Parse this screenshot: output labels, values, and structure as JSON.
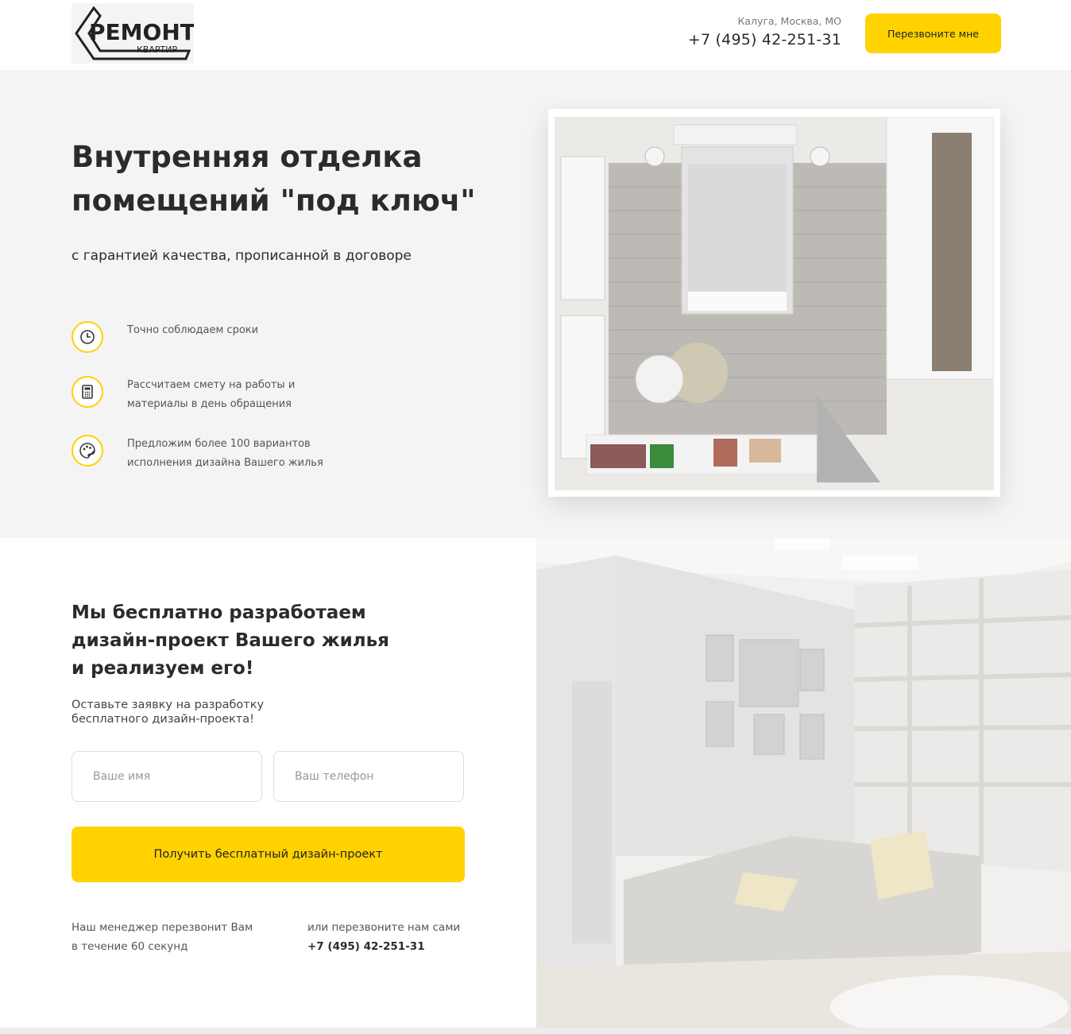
{
  "header": {
    "logo_word": "РЕМОНТ",
    "logo_sub": "КВАРТИР",
    "region": "Калуга, Москва, МО",
    "phone": "+7 (495) 42-251-31",
    "callback_label": "Перезвоните мне"
  },
  "hero": {
    "title": "Внутренняя отделка помещений \"под ключ\"",
    "subtitle": "с гарантией качества, прописанной в договоре",
    "features": [
      {
        "icon": "clock-icon",
        "text": "Точно соблюдаем сроки"
      },
      {
        "icon": "calculator-icon",
        "text": "Рассчитаем смету на работы и материалы в день обращения"
      },
      {
        "icon": "palette-icon",
        "text": "Предложим более 100 вариантов исполнения дизайна Вашего жилья"
      }
    ]
  },
  "form": {
    "title": "Мы бесплатно разработаем дизайн-проект Вашего жилья и реализуем его!",
    "subtitle": "Оставьте заявку на разработку бесплатного дизайн-проекта!",
    "name_placeholder": "Ваше имя",
    "phone_placeholder": "Ваш телефон",
    "submit_label": "Получить бесплатный дизайн-проект",
    "note_left": "Наш менеджер перезвонит Вам в течение 60 секунд",
    "note_right": "или перезвоните нам сами",
    "note_phone": "+7 (495) 42-251-31"
  },
  "colors": {
    "accent": "#ffd200",
    "hero_bg": "#f4f4f4",
    "text": "#2b2b2b"
  }
}
